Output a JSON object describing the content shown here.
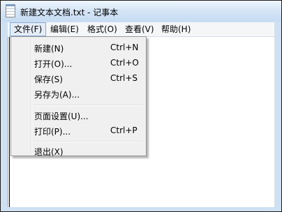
{
  "window": {
    "title": "新建文本文档.txt - 记事本"
  },
  "menubar": {
    "items": [
      {
        "label": "文件(F)",
        "state": "open"
      },
      {
        "label": "编辑(E)"
      },
      {
        "label": "格式(O)"
      },
      {
        "label": "查看(V)"
      },
      {
        "label": "帮助(H)"
      }
    ]
  },
  "file_menu": {
    "items": [
      {
        "label": "新建(N)",
        "shortcut": "Ctrl+N"
      },
      {
        "label": "打开(O)...",
        "shortcut": "Ctrl+O"
      },
      {
        "label": "保存(S)",
        "shortcut": "Ctrl+S"
      },
      {
        "label": "另存为(A)...",
        "shortcut": ""
      },
      {
        "label": "页面设置(U)...",
        "shortcut": ""
      },
      {
        "label": "打印(P)...",
        "shortcut": "Ctrl+P"
      },
      {
        "label": "退出(X)",
        "shortcut": ""
      }
    ]
  },
  "colors": {
    "titlebar": "#c6dbf2",
    "menu_highlight": "#e3ecf7",
    "menu_background": "#f0f0f0"
  }
}
